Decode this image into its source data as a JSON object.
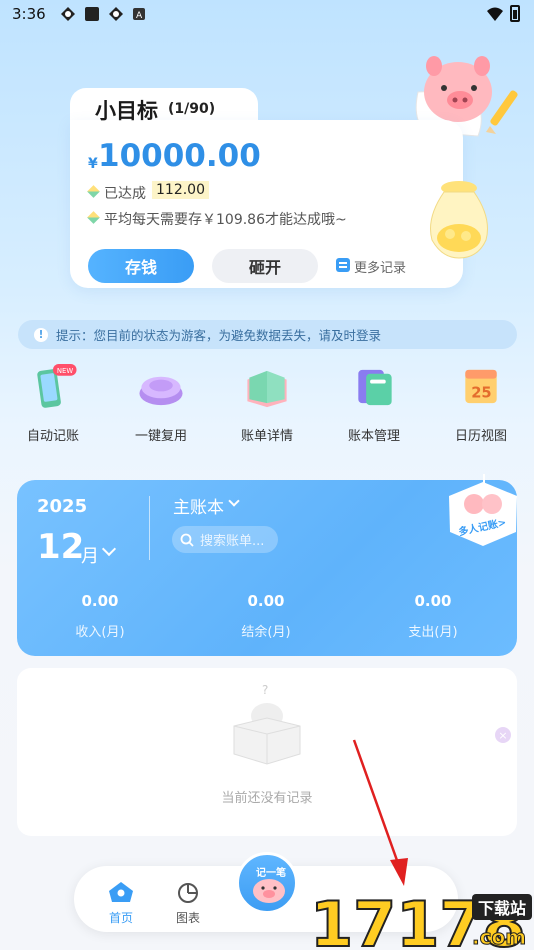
{
  "status_bar": {
    "time": "3:36"
  },
  "goal": {
    "title": "小目标",
    "count": "(1/90)",
    "currency": "¥",
    "amount": "10000.00",
    "achieved_label": "已达成",
    "achieved_value": "112.00",
    "daily_hint": "平均每天需要存￥109.86才能达成哦~",
    "save_button": "存钱",
    "break_button": "砸开",
    "more_records": "更多记录"
  },
  "notice": {
    "text": "提示：您目前的状态为游客，为避免数据丢失，请及时登录"
  },
  "features": [
    {
      "label": "自动记账",
      "badge": "NEW",
      "icon": "phone-icon"
    },
    {
      "label": "一键复用",
      "icon": "copy-button-icon"
    },
    {
      "label": "账单详情",
      "icon": "bill-book-icon"
    },
    {
      "label": "账本管理",
      "icon": "ledger-icon"
    },
    {
      "label": "日历视图",
      "icon": "calendar-icon"
    }
  ],
  "feature_calendar_day": "25",
  "account": {
    "year": "2025",
    "month": "12",
    "month_unit": "月",
    "book_name": "主账本",
    "search_placeholder": "搜索账单...",
    "multi_user_badge": "多人记账>",
    "stats": [
      {
        "value": "0.00",
        "label": "收入(月)"
      },
      {
        "value": "0.00",
        "label": "结余(月)"
      },
      {
        "value": "0.00",
        "label": "支出(月)"
      }
    ]
  },
  "empty_state": {
    "text": "当前还没有记录"
  },
  "bottom_nav": {
    "home": "首页",
    "chart": "图表",
    "center": "记一笔"
  },
  "watermark": {
    "brand": "17178",
    "suffix": ".com",
    "tag": "下载站"
  },
  "colors": {
    "accent": "#3a9df5",
    "card_blue": "#6cbcff"
  }
}
